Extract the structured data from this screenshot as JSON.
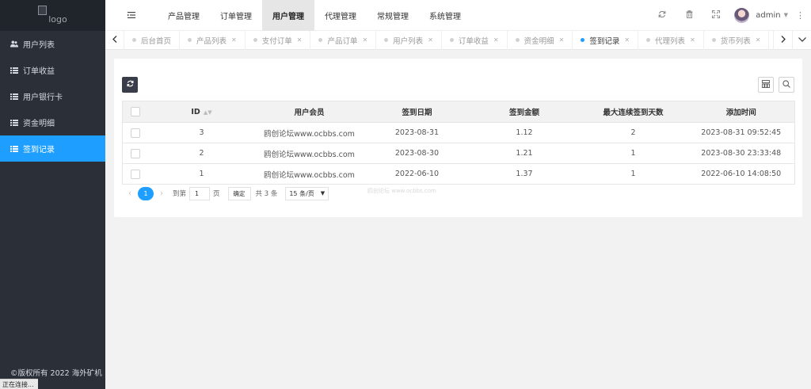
{
  "logo": {
    "alt_text": "logo"
  },
  "sidebar": {
    "items": [
      {
        "label": "用户列表",
        "icon": "users-icon",
        "active": false
      },
      {
        "label": "订单收益",
        "icon": "list-icon",
        "active": false
      },
      {
        "label": "用户银行卡",
        "icon": "list-icon",
        "active": false
      },
      {
        "label": "资金明细",
        "icon": "list-icon",
        "active": false
      },
      {
        "label": "签到记录",
        "icon": "list-icon",
        "active": true
      }
    ],
    "copyright": "©版权所有 2022 海外矿机"
  },
  "status_bar": {
    "text": "正在连接..."
  },
  "header": {
    "nav": [
      {
        "label": "产品管理",
        "active": false
      },
      {
        "label": "订单管理",
        "active": false
      },
      {
        "label": "用户管理",
        "active": true
      },
      {
        "label": "代理管理",
        "active": false
      },
      {
        "label": "常规管理",
        "active": false
      },
      {
        "label": "系统管理",
        "active": false
      }
    ],
    "username": "admin"
  },
  "tabs": [
    {
      "label": "后台首页",
      "closable": false,
      "active": false
    },
    {
      "label": "产品列表",
      "closable": true,
      "active": false
    },
    {
      "label": "支付订单",
      "closable": true,
      "active": false
    },
    {
      "label": "产品订单",
      "closable": true,
      "active": false
    },
    {
      "label": "用户列表",
      "closable": true,
      "active": false
    },
    {
      "label": "订单收益",
      "closable": true,
      "active": false
    },
    {
      "label": "资金明细",
      "closable": true,
      "active": false
    },
    {
      "label": "签到记录",
      "closable": true,
      "active": true
    },
    {
      "label": "代理列表",
      "closable": true,
      "active": false
    },
    {
      "label": "货币列表",
      "closable": true,
      "active": false
    }
  ],
  "table": {
    "columns": [
      "ID",
      "用户会员",
      "签到日期",
      "签到金额",
      "最大连续签到天数",
      "添加时间"
    ],
    "rows": [
      {
        "id": "3",
        "member": "鸥创论坛www.ocbbs.com",
        "date": "2023-08-31",
        "amount": "1.12",
        "max_days": "2",
        "added": "2023-08-31 09:52:45"
      },
      {
        "id": "2",
        "member": "鸥创论坛www.ocbbs.com",
        "date": "2023-08-30",
        "amount": "1.21",
        "max_days": "1",
        "added": "2023-08-30 23:33:48"
      },
      {
        "id": "1",
        "member": "鸥创论坛www.ocbbs.com",
        "date": "2022-06-10",
        "amount": "1.37",
        "max_days": "1",
        "added": "2022-06-10 14:08:50"
      }
    ]
  },
  "pagination": {
    "current_page": "1",
    "goto_prefix": "到第",
    "goto_value": "1",
    "goto_suffix": "页",
    "confirm_label": "确定",
    "total": "共 3 条",
    "page_size": "15 条/页"
  },
  "watermark": "鸥创论坛 www.ocbbs.com",
  "colors": {
    "accent": "#1e9fff",
    "sidebar_bg": "#2a2f38",
    "dark_button": "#393d49"
  }
}
